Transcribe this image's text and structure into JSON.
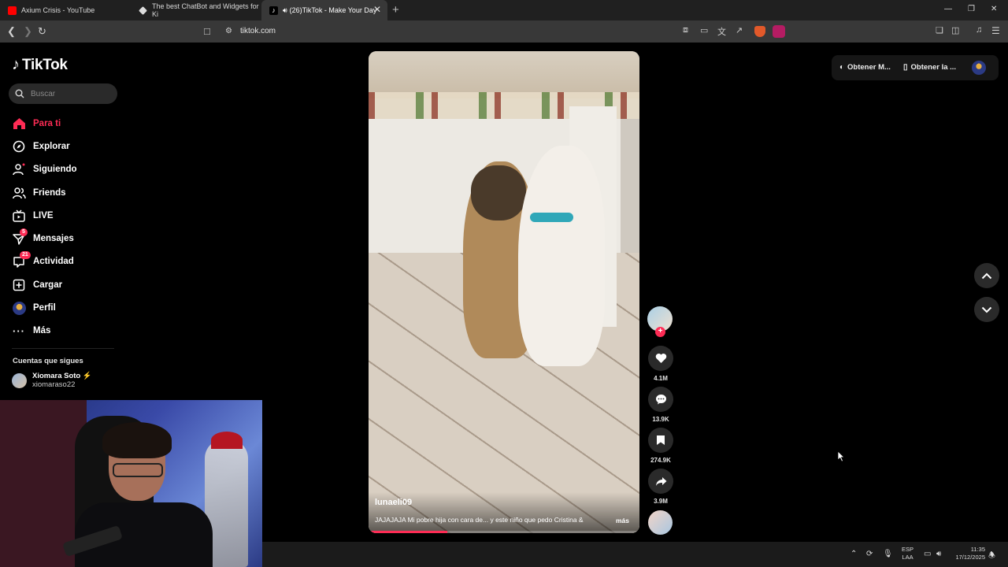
{
  "browser": {
    "tabs": [
      {
        "title": "Axium Crisis - YouTube",
        "favicon_color": "#ff0000"
      },
      {
        "title": "The best ChatBot and Widgets for Ki",
        "favicon_color": "#dddddd"
      },
      {
        "title": "(26)TikTok - Make Your Day",
        "favicon_color": "#ffffff"
      }
    ],
    "url": "tiktok.com"
  },
  "sidebar": {
    "logo": "TikTok",
    "search_placeholder": "Buscar",
    "nav": [
      {
        "label": "Para ti",
        "icon": "home-icon",
        "active": true
      },
      {
        "label": "Explorar",
        "icon": "compass-icon"
      },
      {
        "label": "Siguiendo",
        "icon": "following-icon"
      },
      {
        "label": "Friends",
        "icon": "friends-icon"
      },
      {
        "label": "LIVE",
        "icon": "live-icon"
      },
      {
        "label": "Mensajes",
        "icon": "messages-icon",
        "badge": "5"
      },
      {
        "label": "Actividad",
        "icon": "activity-icon",
        "badge": "21"
      },
      {
        "label": "Cargar",
        "icon": "upload-icon"
      },
      {
        "label": "Perfil",
        "icon": "profile-avatar"
      },
      {
        "label": "Más",
        "icon": "more-icon"
      }
    ],
    "following_title": "Cuentas que sigues",
    "following": [
      {
        "name": "Xiomara Soto ⚡",
        "username": "xiomaraso22"
      }
    ]
  },
  "video": {
    "username": "lunaeli09",
    "caption": "JAJAJAJA Mi pobre hija con cara de... y este niño que pedo Cristina &",
    "more_label": "más",
    "progress": 0.29
  },
  "actions": {
    "likes": "4.1M",
    "comments": "13.9K",
    "saves": "274.9K",
    "shares": "3.9M"
  },
  "topbar": {
    "get_coins": "Obtener M...",
    "get_app": "Obtener la ..."
  },
  "taskbar": {
    "lang_line1": "ESP",
    "lang_line2": "LAA",
    "time": "11:35",
    "date": "17/12/2025"
  },
  "colors": {
    "accent": "#fe2c55",
    "background": "#000000",
    "tab_strip": "#202020",
    "toolbar": "#383838"
  }
}
